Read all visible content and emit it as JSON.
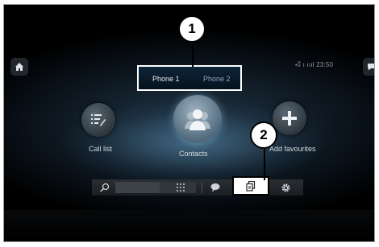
{
  "phone_tabs": {
    "tab1": "Phone 1",
    "tab2": "Phone 2"
  },
  "status_bar": {
    "time": "23:50",
    "signal_text": "▪⁑ ı ıııl"
  },
  "actions": {
    "call_list": "Call list",
    "contacts": "Contacts",
    "add_favourites": "Add favourites"
  },
  "callouts": {
    "one": "1",
    "two": "2"
  },
  "icons": [
    "home-icon",
    "message-icon",
    "call-list-icon",
    "contacts-icon",
    "plus-icon",
    "search-icon",
    "keypad-icon",
    "chat-icon",
    "recent-calls-icon",
    "gear-icon"
  ],
  "colors": {
    "background": "#000000",
    "glow": "#6096b9",
    "highlight_border": "#ffffff"
  }
}
